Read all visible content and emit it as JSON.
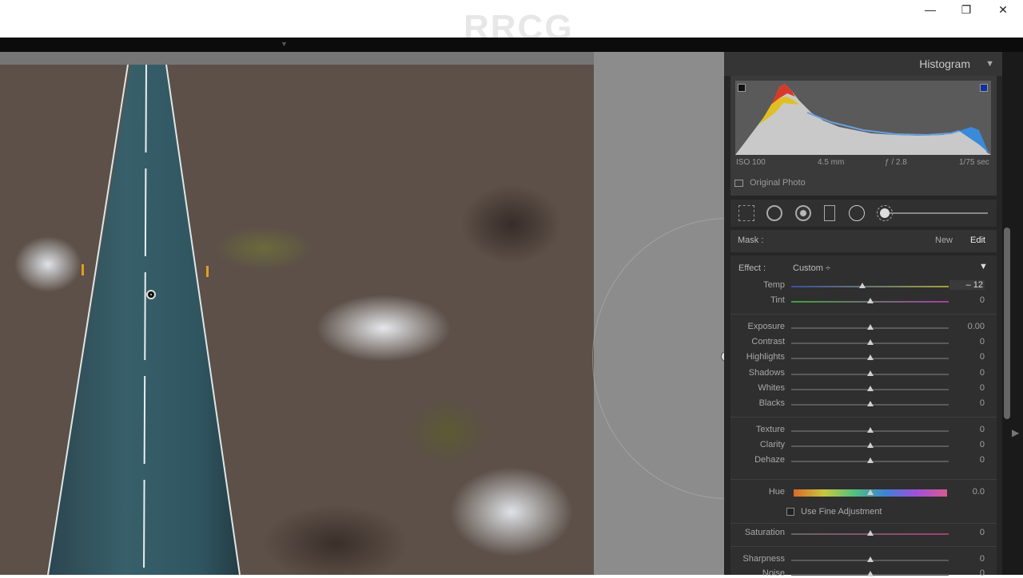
{
  "window": {
    "minimize": "—",
    "restore": "❐",
    "close": "✕"
  },
  "watermark": "RRCG",
  "histogram": {
    "title": "Histogram",
    "iso": "ISO 100",
    "focal": "4.5 mm",
    "aperture": "ƒ / 2.8",
    "shutter": "1/75 sec",
    "original_photo": "Original Photo"
  },
  "mask": {
    "label": "Mask :",
    "new": "New",
    "edit": "Edit"
  },
  "effect": {
    "label": "Effect :",
    "value": "Custom ÷"
  },
  "sliders": [
    {
      "label": "Temp",
      "value": "– 12",
      "pos": 0.45
    },
    {
      "label": "Tint",
      "value": "0",
      "pos": 0.5
    },
    {
      "label": "Exposure",
      "value": "0.00",
      "pos": 0.5
    },
    {
      "label": "Contrast",
      "value": "0",
      "pos": 0.5
    },
    {
      "label": "Highlights",
      "value": "0",
      "pos": 0.5
    },
    {
      "label": "Shadows",
      "value": "0",
      "pos": 0.5
    },
    {
      "label": "Whites",
      "value": "0",
      "pos": 0.5
    },
    {
      "label": "Blacks",
      "value": "0",
      "pos": 0.5
    },
    {
      "label": "Texture",
      "value": "0",
      "pos": 0.5
    },
    {
      "label": "Clarity",
      "value": "0",
      "pos": 0.5
    },
    {
      "label": "Dehaze",
      "value": "0",
      "pos": 0.5
    },
    {
      "label": "Hue",
      "value": "0.0",
      "pos": 0.5
    },
    {
      "label": "Saturation",
      "value": "0",
      "pos": 0.5
    },
    {
      "label": "Sharpness",
      "value": "0",
      "pos": 0.5
    },
    {
      "label": "Noise",
      "value": "0",
      "pos": 0.5
    }
  ],
  "fine_adjustment": "Use Fine Adjustment",
  "colors": {
    "panel": "#262626",
    "accent": "#cfcfcf"
  }
}
